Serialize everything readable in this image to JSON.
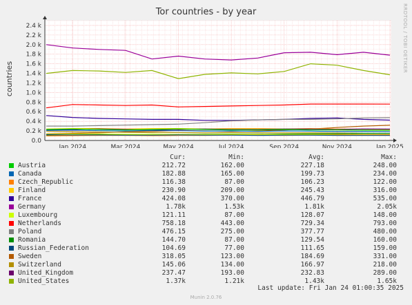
{
  "title": "Tor countries - by year",
  "watermark": "RRDTOOL / TOBI OETIKER",
  "ylabel": "countries",
  "footer": "Munin 2.0.76",
  "last_update": "Last update: Fri Jan 24 01:00:35 2025",
  "legend_headers": {
    "cur": "Cur:",
    "min": "Min:",
    "avg": "Avg:",
    "max": "Max:"
  },
  "legend": [
    {
      "name": "Austria",
      "color": "#00cc00",
      "cur": "212.72",
      "min": "162.00",
      "avg": "227.18",
      "max": "248.00"
    },
    {
      "name": "Canada",
      "color": "#0066b3",
      "cur": "182.88",
      "min": "165.00",
      "avg": "199.73",
      "max": "234.00"
    },
    {
      "name": "Czech_Republic",
      "color": "#ff8000",
      "cur": "116.38",
      "min": "87.00",
      "avg": "106.23",
      "max": "122.00"
    },
    {
      "name": "Finland",
      "color": "#ffcc00",
      "cur": "230.90",
      "min": "209.00",
      "avg": "245.43",
      "max": "316.00"
    },
    {
      "name": "France",
      "color": "#330099",
      "cur": "424.08",
      "min": "370.00",
      "avg": "446.79",
      "max": "535.00"
    },
    {
      "name": "Germany",
      "color": "#990099",
      "cur": "1.78k",
      "min": "1.53k",
      "avg": "1.81k",
      "max": "2.05k"
    },
    {
      "name": "Luxembourg",
      "color": "#ccff00",
      "cur": "121.11",
      "min": "87.00",
      "avg": "128.07",
      "max": "148.00"
    },
    {
      "name": "Netherlands",
      "color": "#ff0000",
      "cur": "758.18",
      "min": "443.00",
      "avg": "729.34",
      "max": "793.00"
    },
    {
      "name": "Poland",
      "color": "#808080",
      "cur": "476.15",
      "min": "275.00",
      "avg": "377.77",
      "max": "480.00"
    },
    {
      "name": "Romania",
      "color": "#008f00",
      "cur": "144.70",
      "min": "87.00",
      "avg": "129.54",
      "max": "160.00"
    },
    {
      "name": "Russian_Federation",
      "color": "#00487d",
      "cur": "104.69",
      "min": "77.00",
      "avg": "111.65",
      "max": "159.00"
    },
    {
      "name": "Sweden",
      "color": "#b35a00",
      "cur": "318.05",
      "min": "123.00",
      "avg": "184.69",
      "max": "331.00"
    },
    {
      "name": "Switzerland",
      "color": "#b38f00",
      "cur": "145.06",
      "min": "134.00",
      "avg": "166.97",
      "max": "218.00"
    },
    {
      "name": "United_Kingdom",
      "color": "#6b006b",
      "cur": "237.47",
      "min": "193.00",
      "avg": "232.83",
      "max": "289.00"
    },
    {
      "name": "United_States",
      "color": "#8fb300",
      "cur": "1.37k",
      "min": "1.21k",
      "avg": "1.43k",
      "max": "1.65k"
    }
  ],
  "chart_data": {
    "type": "line",
    "title": "Tor countries - by year",
    "ylabel": "countries",
    "ylim": [
      0,
      2500
    ],
    "y_ticks": [
      {
        "v": 0,
        "label": "0.0"
      },
      {
        "v": 200,
        "label": "0.2 k"
      },
      {
        "v": 400,
        "label": "0.4 k"
      },
      {
        "v": 600,
        "label": "0.6 k"
      },
      {
        "v": 800,
        "label": "0.8 k"
      },
      {
        "v": 1000,
        "label": "1.0 k"
      },
      {
        "v": 1200,
        "label": "1.2 k"
      },
      {
        "v": 1400,
        "label": "1.4 k"
      },
      {
        "v": 1600,
        "label": "1.6 k"
      },
      {
        "v": 1800,
        "label": "1.8 k"
      },
      {
        "v": 2000,
        "label": "2.0 k"
      },
      {
        "v": 2200,
        "label": "2.2 k"
      },
      {
        "v": 2400,
        "label": "2.4 k"
      }
    ],
    "x_ticks": [
      "Jan 2024",
      "Mar 2024",
      "May 2024",
      "Jul 2024",
      "Sep 2024",
      "Nov 2024",
      "Jan 2025"
    ],
    "x": [
      "2023-12",
      "2024-01",
      "2024-02",
      "2024-03",
      "2024-04",
      "2024-05",
      "2024-06",
      "2024-07",
      "2024-08",
      "2024-09",
      "2024-10",
      "2024-11",
      "2024-12",
      "2025-01"
    ],
    "grid": true,
    "series": [
      {
        "name": "Germany",
        "values": [
          2000,
          1930,
          1900,
          1880,
          1700,
          1760,
          1700,
          1680,
          1720,
          1830,
          1840,
          1790,
          1840,
          1780
        ]
      },
      {
        "name": "United_States",
        "values": [
          1400,
          1460,
          1450,
          1420,
          1460,
          1290,
          1380,
          1410,
          1390,
          1440,
          1600,
          1570,
          1460,
          1370
        ]
      },
      {
        "name": "Netherlands",
        "values": [
          680,
          750,
          740,
          730,
          740,
          700,
          710,
          720,
          730,
          740,
          760,
          760,
          760,
          758
        ]
      },
      {
        "name": "France",
        "values": [
          520,
          480,
          460,
          450,
          440,
          440,
          420,
          420,
          430,
          440,
          460,
          470,
          440,
          424
        ]
      },
      {
        "name": "Poland",
        "values": [
          300,
          300,
          310,
          320,
          330,
          340,
          370,
          410,
          430,
          440,
          440,
          450,
          470,
          476
        ]
      },
      {
        "name": "Sweden",
        "values": [
          140,
          150,
          160,
          180,
          190,
          210,
          200,
          190,
          200,
          220,
          240,
          270,
          300,
          318
        ]
      },
      {
        "name": "Finland",
        "values": [
          240,
          250,
          250,
          240,
          250,
          250,
          240,
          250,
          250,
          240,
          250,
          240,
          235,
          231
        ]
      },
      {
        "name": "United_Kingdom",
        "values": [
          220,
          230,
          240,
          230,
          220,
          230,
          240,
          230,
          230,
          240,
          240,
          230,
          240,
          237
        ]
      },
      {
        "name": "Austria",
        "values": [
          230,
          240,
          230,
          220,
          230,
          240,
          230,
          220,
          220,
          230,
          220,
          220,
          215,
          213
        ]
      },
      {
        "name": "Canada",
        "values": [
          210,
          215,
          205,
          200,
          210,
          205,
          195,
          200,
          190,
          200,
          195,
          185,
          185,
          183
        ]
      },
      {
        "name": "Switzerland",
        "values": [
          190,
          180,
          175,
          170,
          165,
          165,
          160,
          165,
          160,
          160,
          160,
          155,
          150,
          145
        ]
      },
      {
        "name": "Romania",
        "values": [
          110,
          115,
          120,
          125,
          130,
          125,
          130,
          135,
          130,
          135,
          140,
          140,
          145,
          145
        ]
      },
      {
        "name": "Luxembourg",
        "values": [
          130,
          135,
          135,
          130,
          130,
          125,
          125,
          130,
          125,
          125,
          125,
          120,
          120,
          121
        ]
      },
      {
        "name": "Czech_Republic",
        "values": [
          95,
          100,
          105,
          105,
          100,
          105,
          105,
          110,
          110,
          105,
          110,
          115,
          115,
          116
        ]
      },
      {
        "name": "Russian_Federation",
        "values": [
          120,
          115,
          115,
          110,
          110,
          115,
          110,
          110,
          105,
          110,
          110,
          105,
          105,
          105
        ]
      }
    ]
  }
}
